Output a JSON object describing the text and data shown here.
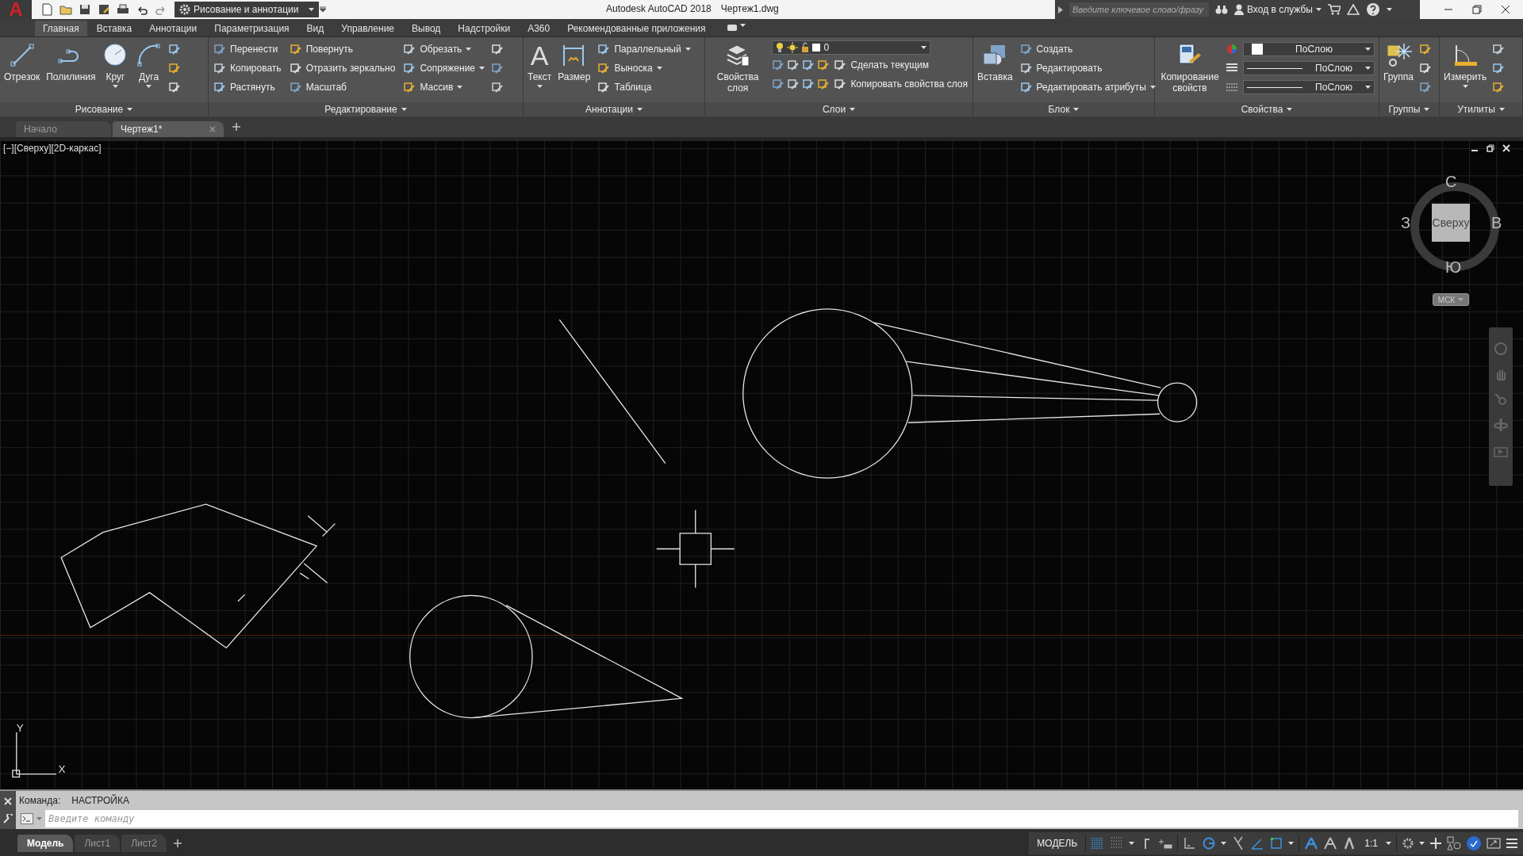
{
  "title_bar": {
    "app_button": "A",
    "workspace": "Рисование и аннотации",
    "title": "Autodesk AutoCAD 2018",
    "document": "Чертеж1.dwg",
    "search": {
      "placeholder": "Введите ключевое слово/фразу"
    },
    "sign_in": "Вход в службы"
  },
  "ribbon": {
    "tabs": [
      {
        "label": "Главная",
        "selected": true
      },
      {
        "label": "Вставка",
        "selected": false
      },
      {
        "label": "Аннотации",
        "selected": false
      },
      {
        "label": "Параметризация",
        "selected": false
      },
      {
        "label": "Вид",
        "selected": false
      },
      {
        "label": "Управление",
        "selected": false
      },
      {
        "label": "Вывод",
        "selected": false
      },
      {
        "label": "Надстройки",
        "selected": false
      },
      {
        "label": "A360",
        "selected": false
      },
      {
        "label": "Рекомендованные приложения",
        "selected": false
      }
    ],
    "panels": [
      {
        "title": "Рисование",
        "items": [
          {
            "kind": "large",
            "label": "Отрезок",
            "menu": false
          },
          {
            "kind": "large",
            "label": "Полилиния",
            "menu": false
          },
          {
            "kind": "large",
            "label": "Круг",
            "menu": true
          },
          {
            "kind": "large",
            "label": "Дуга",
            "menu": true
          },
          {
            "kind": "icons"
          }
        ]
      },
      {
        "title": "Редактирование",
        "items": [
          {
            "kind": "column",
            "rows": [
              {
                "label": "Перенести",
                "menu": false
              },
              {
                "label": "Копировать",
                "menu": false
              },
              {
                "label": "Растянуть",
                "menu": false
              }
            ]
          },
          {
            "kind": "column",
            "rows": [
              {
                "label": "Повернуть",
                "menu": false
              },
              {
                "label": "Отразить зеркально",
                "menu": false
              },
              {
                "label": "Масштаб",
                "menu": false
              }
            ]
          },
          {
            "kind": "column",
            "rows": [
              {
                "label": "Обрезать",
                "menu": true
              },
              {
                "label": "Сопряжение",
                "menu": true
              },
              {
                "label": "Массив",
                "menu": true
              }
            ]
          },
          {
            "kind": "icons"
          }
        ]
      },
      {
        "title": "Аннотации",
        "items": [
          {
            "kind": "large",
            "label": "Текст",
            "glyph": "A",
            "menu": true
          },
          {
            "kind": "large",
            "label": "Размер",
            "menu": false
          },
          {
            "kind": "column",
            "rows": [
              {
                "label": "Параллельный",
                "menu": true
              },
              {
                "label": "Выноска",
                "menu": true
              },
              {
                "label": "Таблица",
                "menu": false
              }
            ]
          }
        ]
      },
      {
        "title": "Слои",
        "items": [
          {
            "kind": "large",
            "label": "Свойства слоя",
            "menu": false
          },
          {
            "kind": "layers",
            "value": "0",
            "rows": [
              {
                "label": "Сделать текущим",
                "menu": false
              },
              {
                "label": "Копировать свойства слоя",
                "menu": false
              }
            ]
          }
        ]
      },
      {
        "title": "Блок",
        "items": [
          {
            "kind": "large",
            "label": "Вставка",
            "menu": false
          },
          {
            "kind": "column",
            "rows": [
              {
                "label": "Создать",
                "menu": false
              },
              {
                "label": "Редактировать",
                "menu": false
              },
              {
                "label": "Редактировать атрибуты",
                "menu": true
              }
            ]
          }
        ]
      },
      {
        "title": "Свойства",
        "items": [
          {
            "kind": "large",
            "label": "Копирование свойств",
            "menu": false
          },
          {
            "kind": "selects",
            "rows": [
              {
                "value": "ПоСлою"
              },
              {
                "value": "ПоСлою"
              },
              {
                "value": "ПоСлою"
              }
            ]
          }
        ]
      },
      {
        "title": "Группы",
        "items": [
          {
            "kind": "large",
            "label": "Группа",
            "menu": false
          },
          {
            "kind": "icons"
          }
        ]
      },
      {
        "title": "Утилиты",
        "items": [
          {
            "kind": "large",
            "label": "Измерить",
            "menu": true
          },
          {
            "kind": "icons"
          }
        ]
      }
    ]
  },
  "file_tabs": [
    {
      "label": "Начало",
      "selected": false
    },
    {
      "label": "Чертеж1*",
      "selected": true
    }
  ],
  "viewport": {
    "label": "[−][Сверху][2D-каркас]",
    "view_cube": {
      "north": "С",
      "west": "З",
      "east": "В",
      "south": "Ю",
      "face": "Сверху",
      "ucs": "МСК"
    },
    "axes": {
      "x": "X",
      "y": "Y"
    }
  },
  "command": {
    "prompt": "Команда:",
    "value": "НАСТРОЙКА",
    "input": {
      "placeholder": "Введите команду"
    }
  },
  "layout_tabs": [
    {
      "label": "Модель",
      "selected": true
    },
    {
      "label": "Лист1",
      "selected": false
    },
    {
      "label": "Лист2",
      "selected": false
    }
  ],
  "status_bar": {
    "model": "МОДЕЛЬ",
    "scale": "1:1",
    "toggles": [
      {
        "on": true
      },
      {
        "on": false
      },
      {
        "on": false
      },
      {
        "on": false
      },
      {
        "on": false
      },
      {
        "on": true
      },
      {
        "on": false
      },
      {
        "on": true
      },
      {
        "on": true
      },
      {
        "on": true
      },
      {
        "on": false
      },
      {
        "on": false
      }
    ]
  }
}
